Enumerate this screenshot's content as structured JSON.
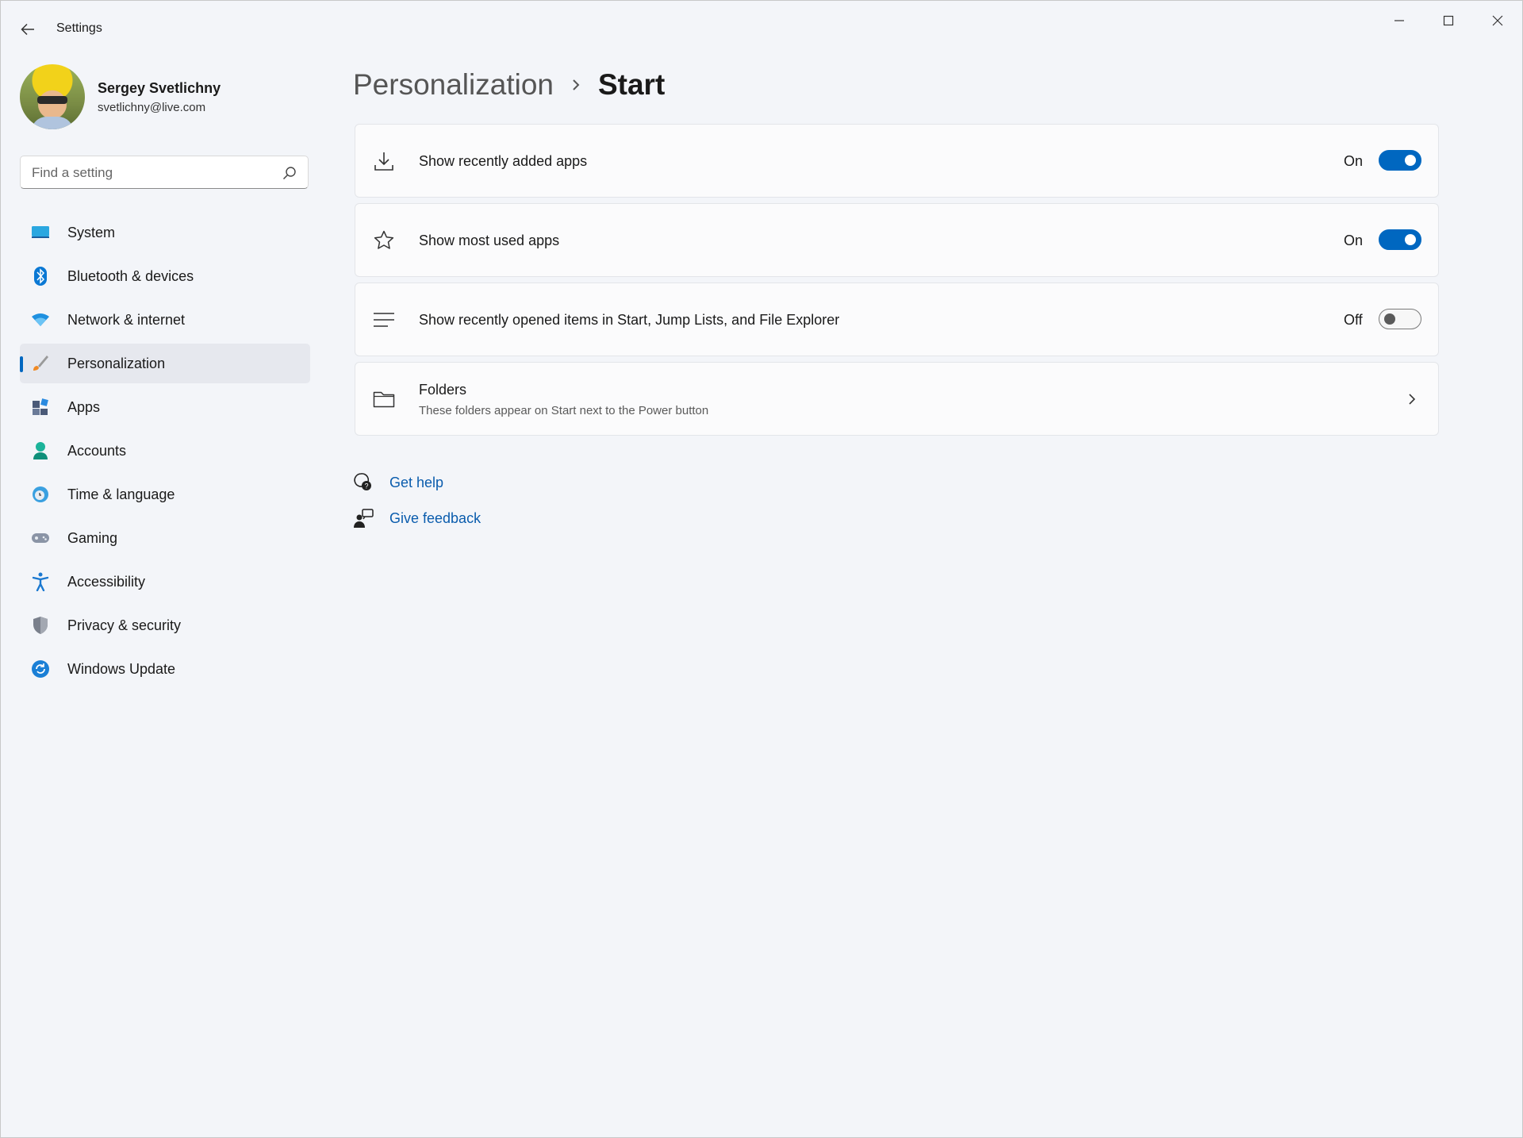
{
  "window": {
    "title": "Settings"
  },
  "profile": {
    "name": "Sergey Svetlichny",
    "email": "svetlichny@live.com"
  },
  "search": {
    "placeholder": "Find a setting"
  },
  "sidebar": {
    "items": [
      {
        "label": "System",
        "icon": "system-icon"
      },
      {
        "label": "Bluetooth & devices",
        "icon": "bluetooth-icon"
      },
      {
        "label": "Network & internet",
        "icon": "wifi-icon"
      },
      {
        "label": "Personalization",
        "icon": "brush-icon",
        "active": true
      },
      {
        "label": "Apps",
        "icon": "apps-icon"
      },
      {
        "label": "Accounts",
        "icon": "person-icon"
      },
      {
        "label": "Time & language",
        "icon": "clock-globe-icon"
      },
      {
        "label": "Gaming",
        "icon": "gamepad-icon"
      },
      {
        "label": "Accessibility",
        "icon": "accessibility-icon"
      },
      {
        "label": "Privacy & security",
        "icon": "shield-icon"
      },
      {
        "label": "Windows Update",
        "icon": "update-icon"
      }
    ]
  },
  "breadcrumb": {
    "parent": "Personalization",
    "current": "Start"
  },
  "settings": {
    "recently_added": {
      "label": "Show recently added apps",
      "state": "On",
      "enabled": true,
      "icon": "download-icon"
    },
    "most_used": {
      "label": "Show most used apps",
      "state": "On",
      "enabled": true,
      "icon": "star-icon"
    },
    "recently_opened": {
      "label": "Show recently opened items in Start, Jump Lists, and File Explorer",
      "state": "Off",
      "enabled": false,
      "icon": "list-icon"
    },
    "folders": {
      "label": "Folders",
      "description": "These folders appear on Start next to the Power button",
      "icon": "folder-icon"
    }
  },
  "help_links": {
    "get_help": "Get help",
    "give_feedback": "Give feedback"
  },
  "colors": {
    "accent": "#0067c0",
    "link": "#0a5cad",
    "background": "#f3f5f9",
    "card": "#fbfbfc"
  }
}
